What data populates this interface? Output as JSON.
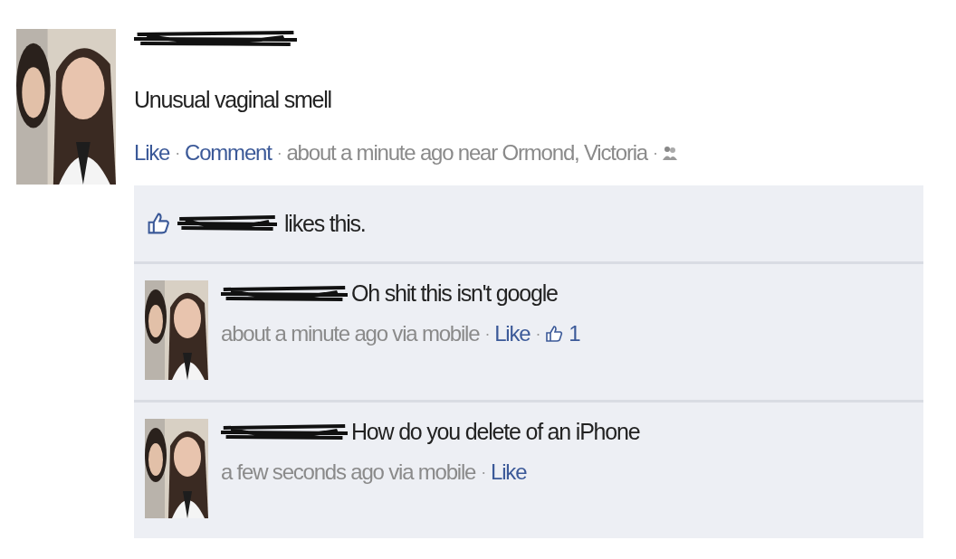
{
  "post": {
    "text": "Unusual vaginal smell",
    "actions": [
      "Like",
      "Comment"
    ],
    "meta": "about a minute ago near Ormond, Victoria",
    "separator": "·"
  },
  "likes": {
    "text": "likes this."
  },
  "comments": [
    {
      "text": "Oh shit this isn't google",
      "time": "about a minute ago via mobile",
      "actions": [
        "Like"
      ],
      "like_count": "1"
    },
    {
      "text": "How do you delete of an iPhone",
      "time": "a few seconds ago via mobile",
      "actions": [
        "Like"
      ]
    }
  ]
}
